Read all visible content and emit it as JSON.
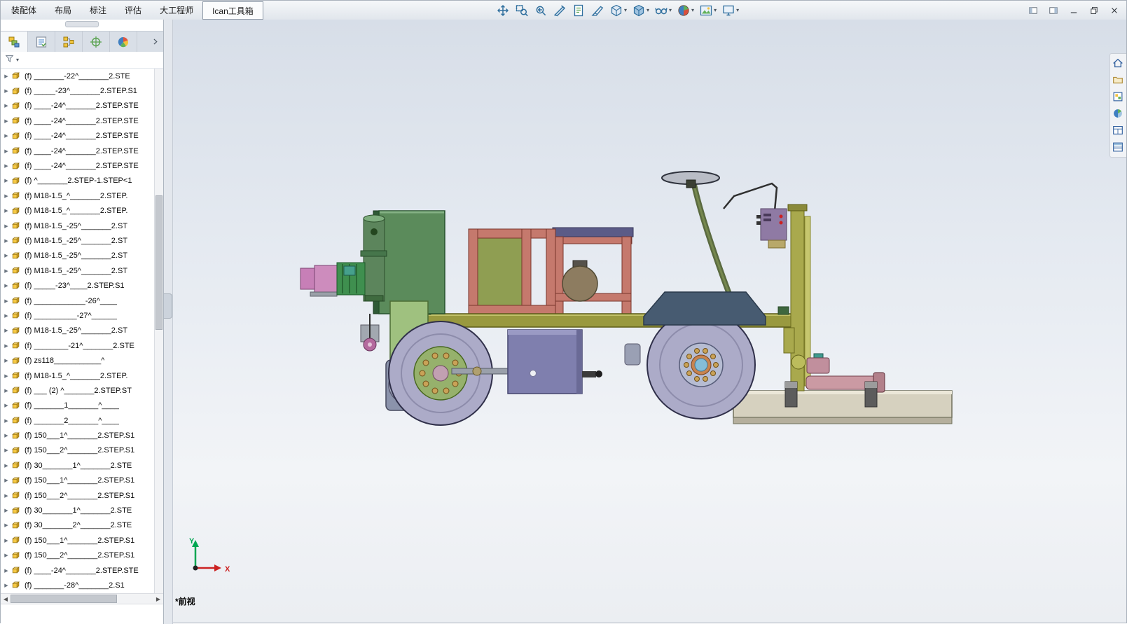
{
  "menu_bar": {
    "tabs": [
      {
        "label": "装配体",
        "active": false
      },
      {
        "label": "布局",
        "active": false
      },
      {
        "label": "标注",
        "active": false
      },
      {
        "label": "评估",
        "active": false
      },
      {
        "label": "大工程师",
        "active": false
      },
      {
        "label": "Ican工具箱",
        "active": true
      }
    ]
  },
  "viewport_toolbar": {
    "caret_glyph": "▾",
    "icons": [
      {
        "name": "zoom-to-fit-icon",
        "dropdown": false
      },
      {
        "name": "zoom-area-icon",
        "dropdown": false
      },
      {
        "name": "previous-view-icon",
        "dropdown": false
      },
      {
        "name": "section-view-icon",
        "dropdown": false
      },
      {
        "name": "annotations-icon",
        "dropdown": false
      },
      {
        "name": "trim-icon",
        "dropdown": false
      },
      {
        "name": "view-orientation-icon",
        "dropdown": true
      },
      {
        "name": "display-style-icon",
        "dropdown": true
      },
      {
        "name": "hide-show-items-icon",
        "dropdown": true
      },
      {
        "name": "edit-appearance-icon",
        "dropdown": true
      },
      {
        "name": "apply-scene-icon",
        "dropdown": true
      },
      {
        "name": "view-settings-icon",
        "dropdown": true
      }
    ]
  },
  "window_controls": [
    {
      "name": "pane-left-icon"
    },
    {
      "name": "pane-right-icon"
    },
    {
      "name": "minimize-icon"
    },
    {
      "name": "restore-icon"
    },
    {
      "name": "close-icon"
    }
  ],
  "left_panel": {
    "tabs": [
      {
        "name": "featuremanager-icon"
      },
      {
        "name": "propertymanager-icon"
      },
      {
        "name": "configurationmanager-icon"
      },
      {
        "name": "dimxpertmanager-icon"
      },
      {
        "name": "displaymanager-icon"
      }
    ],
    "filter": {
      "name": "filter-icon"
    },
    "row_expand_glyph": "▶",
    "hscroll": {
      "left_glyph": "◀",
      "right_glyph": "▶"
    },
    "tree_items": [
      "(f) _______-22^_______2.STE",
      "(f) _____-23^_______2.STEP.S1",
      "(f) ____-24^_______2.STEP.STE",
      "(f) ____-24^_______2.STEP.STE",
      "(f) ____-24^_______2.STEP.STE",
      "(f) ____-24^_______2.STEP.STE",
      "(f) ____-24^_______2.STEP.STE",
      "(f) ^_______2.STEP-1.STEP<1",
      "(f) M18-1.5_^_______2.STEP.",
      "(f) M18-1.5_^_______2.STEP.",
      "(f) M18-1.5_-25^_______2.ST",
      "(f) M18-1.5_-25^_______2.ST",
      "(f) M18-1.5_-25^_______2.ST",
      "(f) M18-1.5_-25^_______2.ST",
      "(f) _____-23^____2.STEP.S1",
      "(f) ____________-26^____",
      "(f) __________-27^______",
      "(f) M18-1.5_-25^_______2.ST",
      "(f) ________-21^_______2.STE",
      "(f) zs118___________^",
      "(f) M18-1.5_^_______2.STEP.",
      "(f) ___ (2) ^_______2.STEP.ST",
      "(f) _______1_______^____",
      "(f) _______2_______^____",
      "(f) 150___1^_______2.STEP.S1",
      "(f) 150___2^_______2.STEP.S1",
      "(f) 30_______1^_______2.STE",
      "(f) 150___1^_______2.STEP.S1",
      "(f) 150___2^_______2.STEP.S1",
      "(f) 30_______1^_______2.STE",
      "(f) 30_______2^_______2.STE",
      "(f) 150___1^_______2.STEP.S1",
      "(f) 150___2^_______2.STEP.S1",
      "(f) ____-24^_______2.STEP.STE",
      "(f) _______-28^_______2.S1"
    ]
  },
  "task_pane": {
    "icons": [
      {
        "name": "home-icon"
      },
      {
        "name": "open-folder-icon"
      },
      {
        "name": "design-library-icon"
      },
      {
        "name": "appearances-icon"
      },
      {
        "name": "view-palette-icon"
      },
      {
        "name": "custom-properties-icon"
      }
    ]
  },
  "viewport": {
    "view_label": "*前视",
    "triad": {
      "x_label": "X",
      "y_label": "Y"
    }
  },
  "colors": {
    "chassis_olive": "#99993f",
    "frame_salmon": "#c5796d",
    "inner_panel_olive": "#8f9e52",
    "box_green": "#5b8b5b",
    "panel_light_green": "#9fc17f",
    "wheel_grey": "#acabc8",
    "hub_green": "#96b16c",
    "fender_slate": "#475b71",
    "purple_box": "#7f7fae",
    "screed_tan": "#d6d1bf",
    "arm_pink": "#cb9aa3",
    "motor_magenta": "#c77fb7",
    "mast_olive": "#a9a94d",
    "triad_y_green": "#00a651",
    "triad_x_red": "#cc2222",
    "viewport_top": "#d7dee8",
    "viewport_bottom": "#ebeef2"
  }
}
